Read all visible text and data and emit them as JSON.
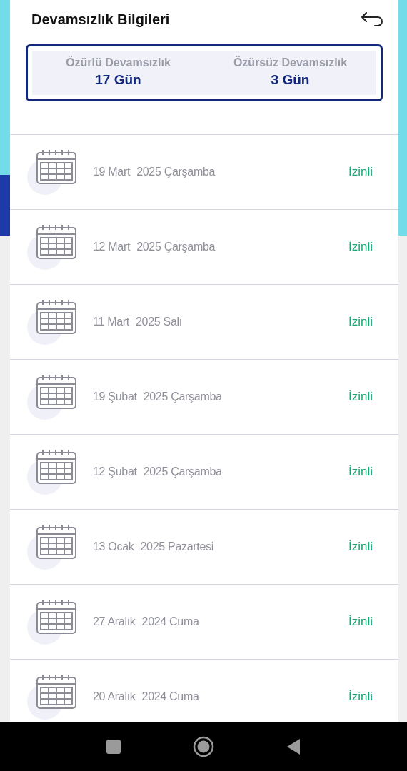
{
  "header": {
    "title": "Devamsızlık Bilgileri"
  },
  "summary": [
    {
      "label": "Özürlü Devamsızlık",
      "value": "17 Gün"
    },
    {
      "label": "Özürsüz Devamsızlık",
      "value": "3 Gün"
    }
  ],
  "records": [
    {
      "date": "19 Mart",
      "year_day": "2025 Çarşamba",
      "status": "İzinli"
    },
    {
      "date": "12 Mart",
      "year_day": "2025 Çarşamba",
      "status": "İzinli"
    },
    {
      "date": "11 Mart",
      "year_day": "2025 Salı",
      "status": "İzinli"
    },
    {
      "date": "19 Şubat",
      "year_day": "2025 Çarşamba",
      "status": "İzinli"
    },
    {
      "date": "12 Şubat",
      "year_day": "2025 Çarşamba",
      "status": "İzinli"
    },
    {
      "date": "13 Ocak",
      "year_day": "2025 Pazartesi",
      "status": "İzinli"
    },
    {
      "date": "27 Aralık",
      "year_day": "2024 Cuma",
      "status": "İzinli"
    },
    {
      "date": "20 Aralık",
      "year_day": "2024 Cuma",
      "status": "İzinli"
    }
  ]
}
